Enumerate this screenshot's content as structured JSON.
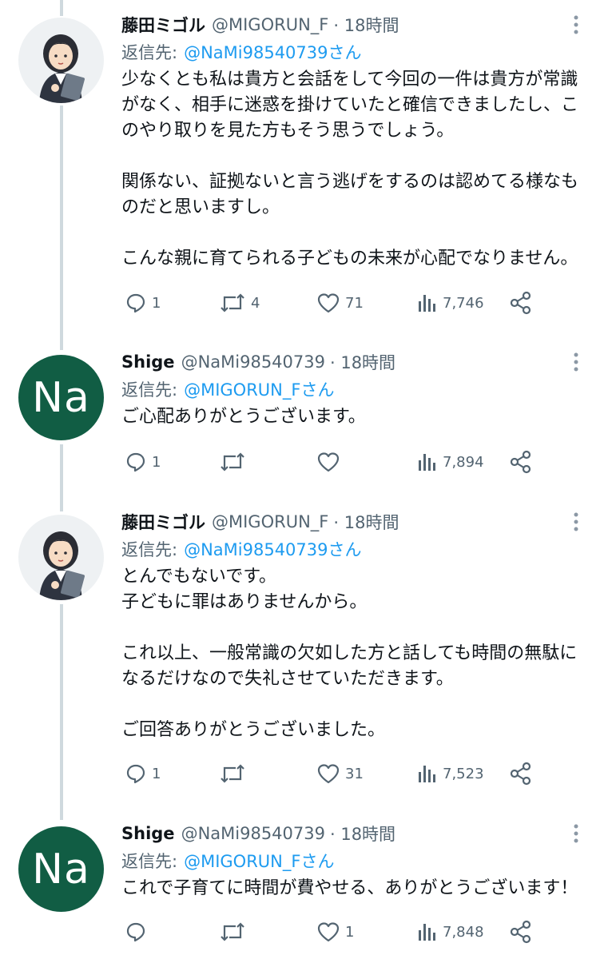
{
  "tweets": [
    {
      "avatar": {
        "kind": "illustration",
        "label": ""
      },
      "name": "藤田ミゴル",
      "handle": "@MIGORUN_F",
      "time": "· 18時間",
      "reply_prefix": "返信先:",
      "reply_to": "@NaMi98540739さん",
      "lines": [
        "少なくとも私は貴方と会話をして今回の一件は貴方が常識",
        "がなく、相手に迷惑を掛けていたと確信できましたし、こ",
        "のやり取りを見た方もそう思うでしょう。",
        "",
        "関係ない、証拠ないと言う逃げをするのは認めてる様なも",
        "のだと思いますし。",
        "",
        "こんな親に育てられる子どもの未来が心配でなりません。"
      ],
      "replies": "1",
      "retweets": "4",
      "likes": "71",
      "views": "7,746"
    },
    {
      "avatar": {
        "kind": "initials",
        "label": "Na"
      },
      "name": "Shige",
      "handle": "@NaMi98540739",
      "time": "· 18時間",
      "reply_prefix": "返信先:",
      "reply_to": "@MIGORUN_Fさん",
      "lines": [
        "ご心配ありがとうございます。"
      ],
      "replies": "1",
      "retweets": "",
      "likes": "",
      "views": "7,894"
    },
    {
      "avatar": {
        "kind": "illustration",
        "label": ""
      },
      "name": "藤田ミゴル",
      "handle": "@MIGORUN_F",
      "time": "· 18時間",
      "reply_prefix": "返信先:",
      "reply_to": "@NaMi98540739さん",
      "lines": [
        "とんでもないです。",
        "子どもに罪はありませんから。",
        "",
        "これ以上、一般常識の欠如した方と話しても時間の無駄に",
        "なるだけなので失礼させていただきます。",
        "",
        "ご回答ありがとうございました。"
      ],
      "replies": "1",
      "retweets": "",
      "likes": "31",
      "views": "7,523"
    },
    {
      "avatar": {
        "kind": "initials",
        "label": "Na"
      },
      "name": "Shige",
      "handle": "@NaMi98540739",
      "time": "· 18時間",
      "reply_prefix": "返信先:",
      "reply_to": "@MIGORUN_Fさん",
      "lines": [
        "これで子育てに時間が費やせる、ありがとうございます！"
      ],
      "replies": "",
      "retweets": "",
      "likes": "1",
      "views": "7,848"
    }
  ],
  "colors": {
    "text": "#0f1419",
    "secondary": "#536471",
    "link": "#1d9bf0",
    "thread_line": "#cfd9de",
    "initials_avatar_bg": "#115d44"
  },
  "icons": [
    "reply-icon",
    "retweet-icon",
    "like-icon",
    "views-icon",
    "share-icon",
    "more-menu-icon"
  ]
}
